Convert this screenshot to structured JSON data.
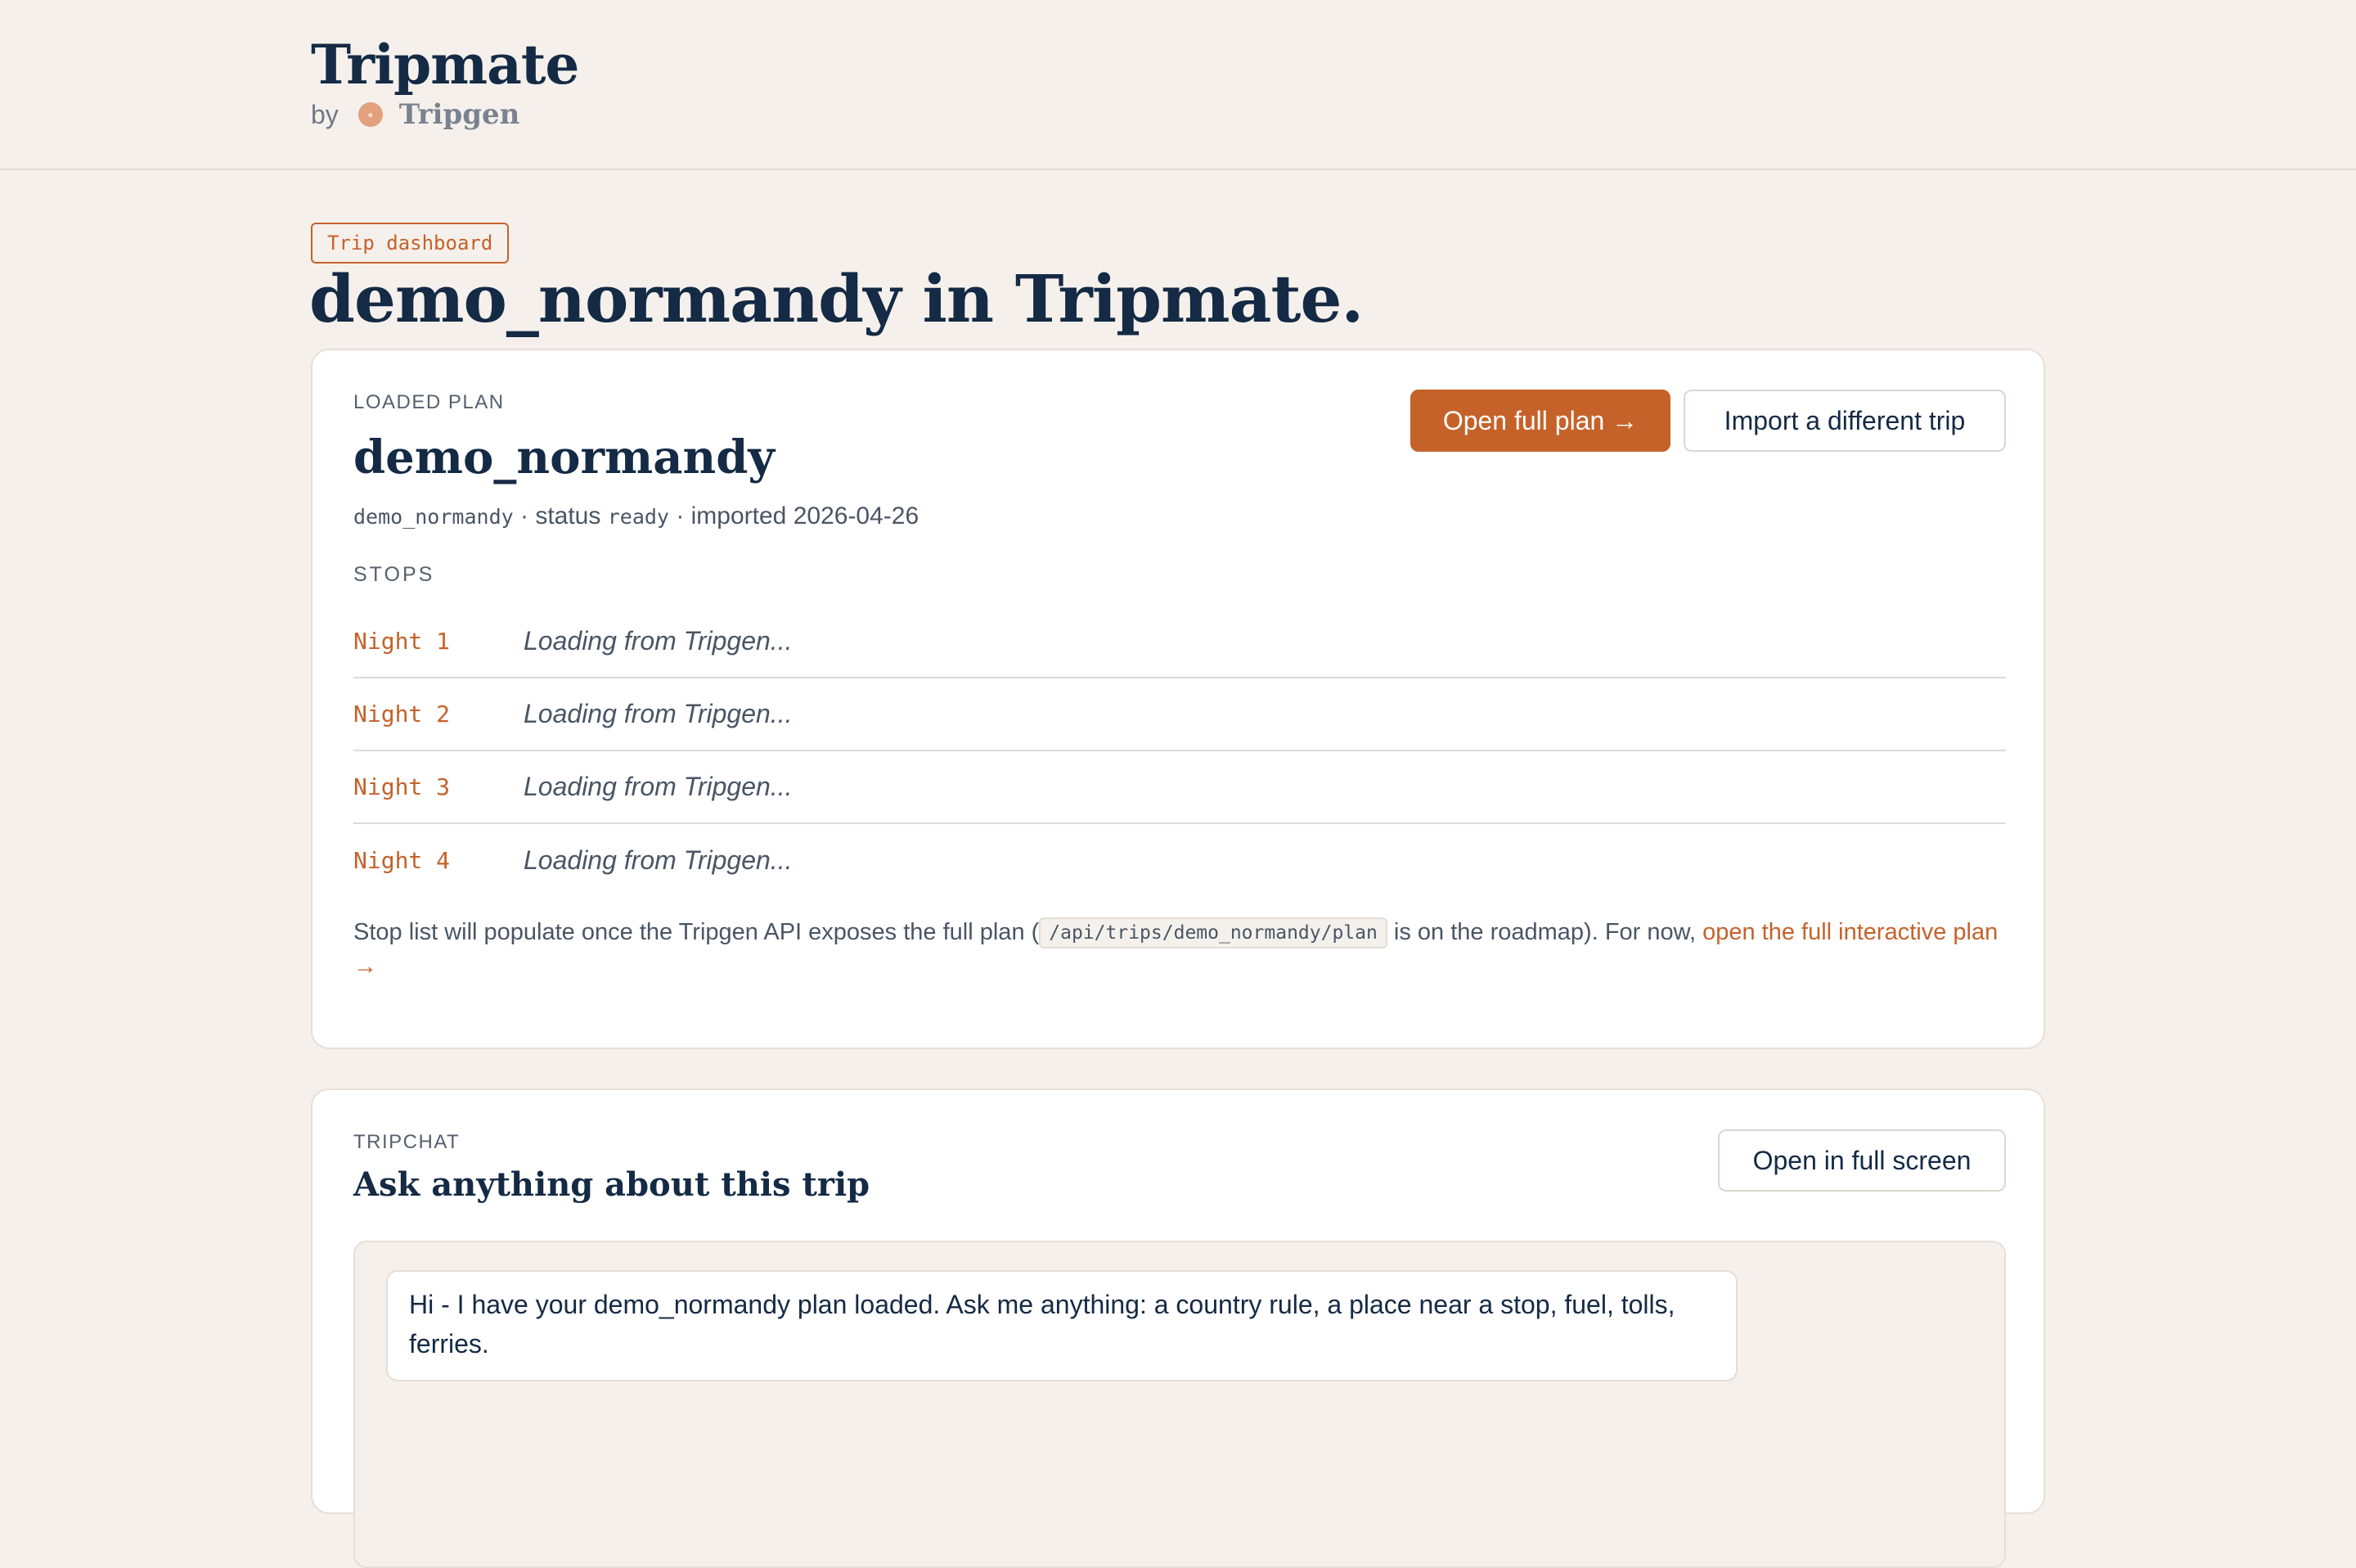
{
  "header": {
    "app_title": "Tripmate",
    "by_label": "by",
    "provider_name": "Tripgen",
    "provider_logo_glyph": "●"
  },
  "hero": {
    "tag": "Trip dashboard",
    "title": "demo_normandy in Tripmate."
  },
  "plan_card": {
    "overline": "LOADED PLAN",
    "plan_name": "demo_normandy",
    "meta": {
      "id": "demo_normandy",
      "sep1": " · status ",
      "status": "ready",
      "sep2": " · imported ",
      "imported_date": "2026-04-26"
    },
    "open_button": "Open full plan →",
    "import_button": "Import a different trip",
    "stops_label": "STOPS",
    "stops": [
      {
        "night": "Night 1",
        "status": "Loading from Tripgen..."
      },
      {
        "night": "Night 2",
        "status": "Loading from Tripgen..."
      },
      {
        "night": "Night 3",
        "status": "Loading from Tripgen..."
      },
      {
        "night": "Night 4",
        "status": "Loading from Tripgen..."
      }
    ],
    "note": {
      "before": "Stop list will populate once the Tripgen API exposes the full plan (",
      "code": "/api/trips/demo_normandy/plan",
      "after": " is on the roadmap). For now, ",
      "link": "open the full interactive plan →"
    }
  },
  "chat_card": {
    "overline": "TRIPCHAT",
    "title": "Ask anything about this trip",
    "fullscreen_button": "Open in full screen",
    "messages": [
      {
        "role": "assistant",
        "text": "Hi - I have your demo_normandy plan loaded. Ask me anything: a country rule, a place near a stop, fuel, tolls, ferries."
      }
    ]
  },
  "colors": {
    "accent": "#c5622a",
    "background": "#f5f0eb",
    "ink": "#142a45"
  }
}
